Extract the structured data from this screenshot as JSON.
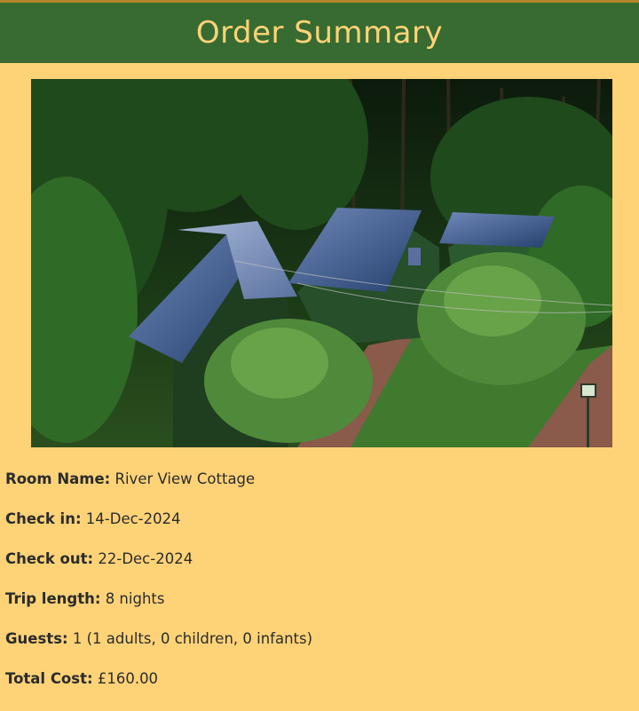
{
  "header": {
    "title": "Order Summary"
  },
  "photo": {
    "description": "green cottages with blue roofs among trees",
    "alt": "River View Cottage"
  },
  "details": {
    "room_name_label": "Room Name:",
    "room_name_value": "River View Cottage",
    "check_in_label": "Check in:",
    "check_in_value": "14-Dec-2024",
    "check_out_label": "Check out:",
    "check_out_value": "22-Dec-2024",
    "trip_length_label": "Trip length:",
    "trip_length_value": "8 nights",
    "guests_label": "Guests:",
    "guests_value": "1 (1 adults, 0 children, 0 infants)",
    "total_cost_label": "Total Cost:",
    "total_cost_value": "£160.00"
  },
  "colors": {
    "background": "#fed378",
    "header_bg": "#386b31",
    "header_text": "#fed378",
    "header_border": "#b4842a"
  }
}
